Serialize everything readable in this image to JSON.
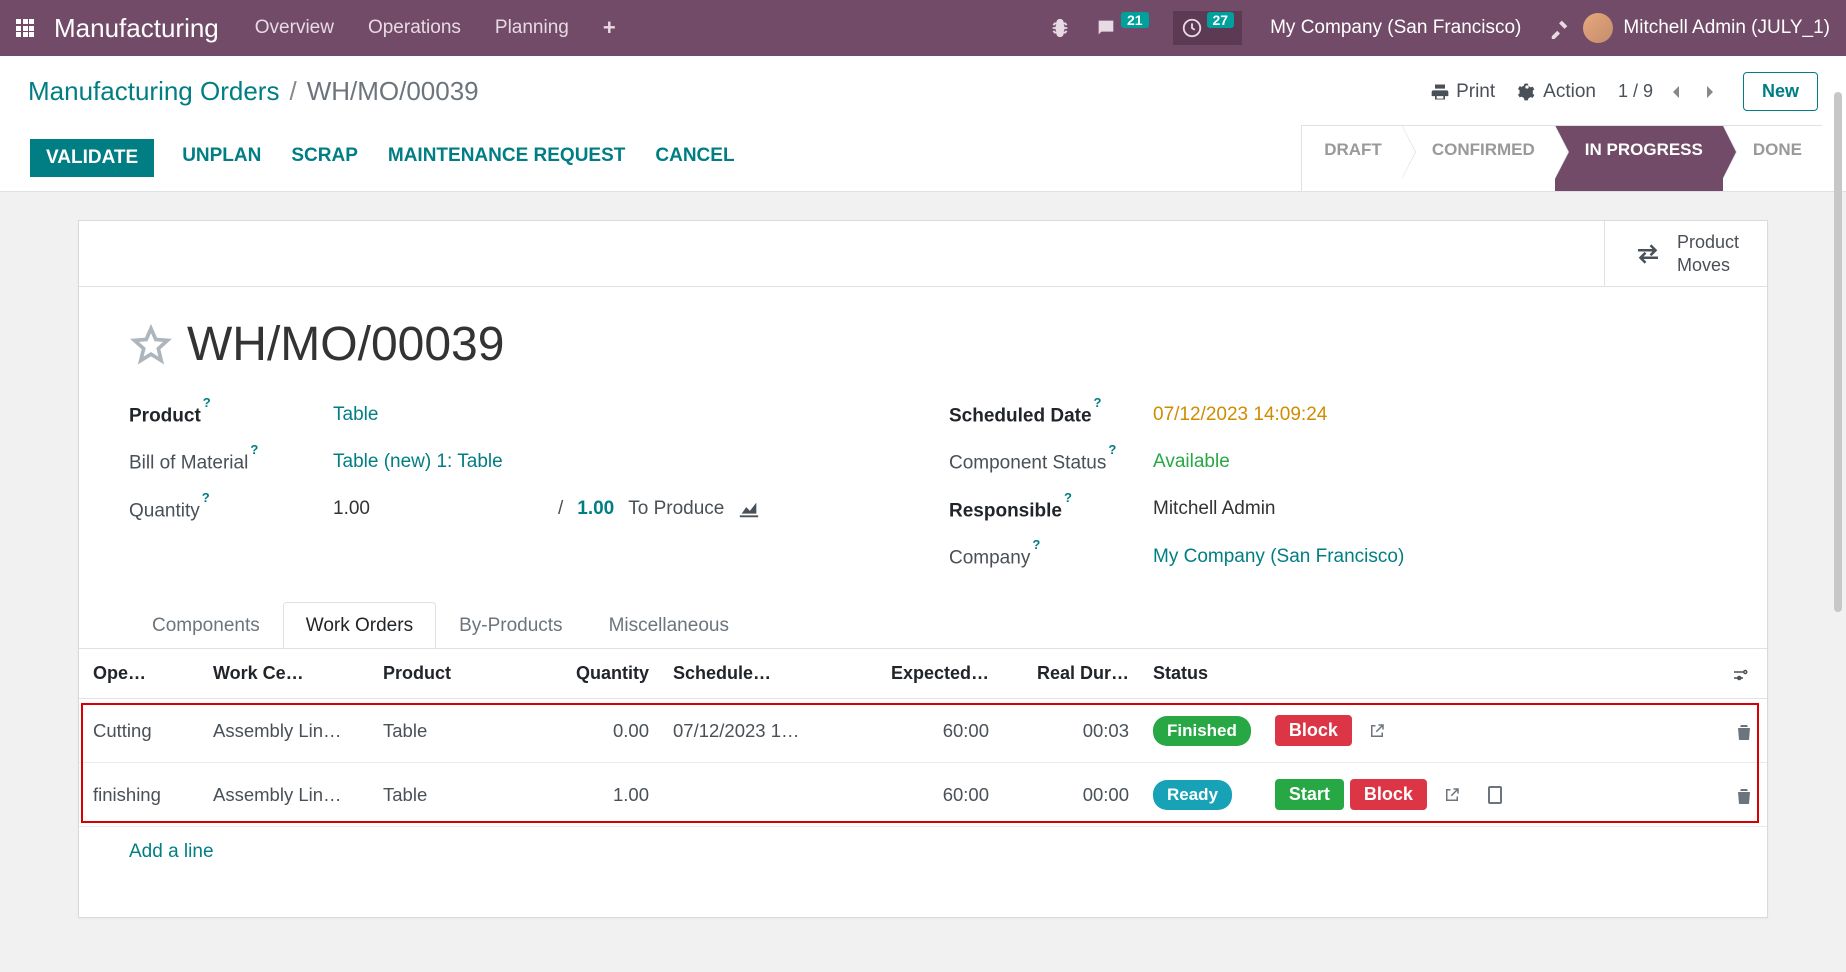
{
  "topnav": {
    "brand": "Manufacturing",
    "items": [
      "Overview",
      "Operations",
      "Planning"
    ],
    "messages_badge": "21",
    "activities_badge": "27",
    "company": "My Company (San Francisco)",
    "username": "Mitchell Admin (JULY_1)"
  },
  "breadcrumb": {
    "link": "Manufacturing Orders",
    "current": "WH/MO/00039"
  },
  "cp": {
    "print": "Print",
    "action": "Action",
    "pager": "1 / 9",
    "new": "New"
  },
  "statusbar": {
    "buttons": [
      "VALIDATE",
      "UNPLAN",
      "SCRAP",
      "MAINTENANCE REQUEST",
      "CANCEL"
    ],
    "stages": [
      "DRAFT",
      "CONFIRMED",
      "IN PROGRESS",
      "DONE"
    ],
    "active_stage": 2
  },
  "button_box": {
    "product_moves": "Product\nMoves"
  },
  "record": {
    "name": "WH/MO/00039",
    "fields_left": {
      "product_label": "Product",
      "product": "Table",
      "bom_label": "Bill of Material",
      "bom": "Table (new) 1: Table",
      "qty_label": "Quantity",
      "qty": "1.00",
      "qty_target": "1.00",
      "qty_suffix": "To Produce"
    },
    "fields_right": {
      "scheduled_label": "Scheduled Date",
      "scheduled": "07/12/2023 14:09:24",
      "compstatus_label": "Component Status",
      "compstatus": "Available",
      "responsible_label": "Responsible",
      "responsible": "Mitchell Admin",
      "company_label": "Company",
      "company": "My Company (San Francisco)"
    }
  },
  "tabs": [
    "Components",
    "Work Orders",
    "By-Products",
    "Miscellaneous"
  ],
  "work_orders": {
    "columns": [
      "Ope…",
      "Work Ce…",
      "Product",
      "Quantity",
      "Schedule…",
      "Expected…",
      "Real Dur…",
      "Status"
    ],
    "rows": [
      {
        "operation": "Cutting",
        "workcenter": "Assembly Lin…",
        "product": "Table",
        "quantity": "0.00",
        "scheduled": "07/12/2023 1…",
        "expected": "60:00",
        "real": "00:03",
        "status": "Finished",
        "status_class": "finished",
        "show_start": false
      },
      {
        "operation": "finishing",
        "workcenter": "Assembly Lin…",
        "product": "Table",
        "quantity": "1.00",
        "scheduled": "",
        "expected": "60:00",
        "real": "00:00",
        "status": "Ready",
        "status_class": "ready",
        "show_start": true
      }
    ],
    "block_label": "Block",
    "start_label": "Start",
    "add_line": "Add a line"
  }
}
